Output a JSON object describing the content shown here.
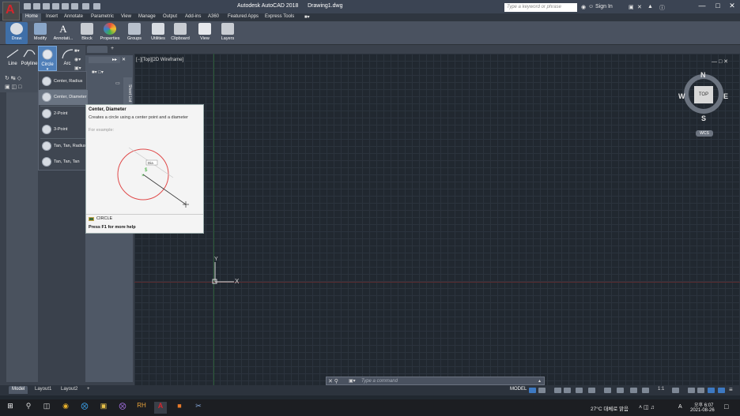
{
  "app": {
    "title": "Autodesk AutoCAD 2018",
    "file": "Drawing1.dwg",
    "search_placeholder": "Type a keyword or phrase",
    "sign_in": "Sign In"
  },
  "ribbon_tabs": [
    "Home",
    "Insert",
    "Annotate",
    "Parametric",
    "View",
    "Manage",
    "Output",
    "Add-ins",
    "A360",
    "Featured Apps",
    "Express Tools"
  ],
  "ribbon_buttons": [
    "Draw",
    "Modify",
    "Annotati...",
    "Block",
    "Properties",
    "Groups",
    "Utilities",
    "Clipboard",
    "View",
    "Layers"
  ],
  "draw_tools": [
    "Line",
    "Polyline",
    "Circle",
    "Arc"
  ],
  "circle_menu": {
    "items": [
      "Center, Radius",
      "Center, Diameter",
      "2-Point",
      "3-Point",
      "Tan, Tan, Radius",
      "Tan, Tan, Tan"
    ],
    "highlighted": "Center, Diameter"
  },
  "tooltip": {
    "title": "Center, Diameter",
    "description": "Creates a circle using a center point and a diameter",
    "example_label": "For example:",
    "dimension_text": "Dia",
    "command": "CIRCLE",
    "help": "Press F1 for more help"
  },
  "palette": {
    "tab_label": "Sheet List"
  },
  "viewport": {
    "label": "[−][Top][2D Wireframe]"
  },
  "viewcube": {
    "top": "TOP",
    "north": "N",
    "south": "S",
    "east": "E",
    "west": "W",
    "wcs": "WCS"
  },
  "ucs": {
    "x": "X",
    "y": "Y"
  },
  "command_line": {
    "placeholder": "Type a command"
  },
  "layout_tabs": [
    "Model",
    "Layout1",
    "Layout2",
    "+"
  ],
  "status": {
    "model": "MODEL",
    "scale": "1:1"
  },
  "taskbar": {
    "weather": "27°C 대체로 맑음",
    "ime": "A",
    "time": "오후 6:07",
    "date": "2021-08-26"
  },
  "colors": {
    "accent": "#3f6fa8",
    "logo": "#d3262d",
    "circle": "#e04a4a"
  }
}
